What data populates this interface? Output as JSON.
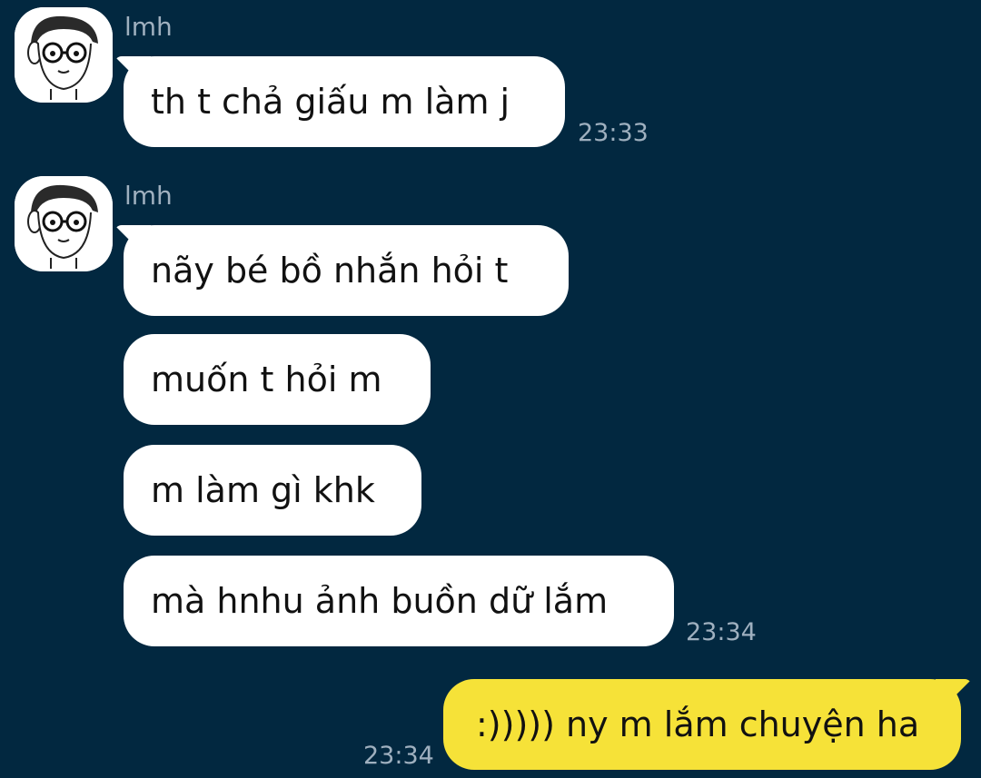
{
  "messages": [
    {
      "sender": "lmh",
      "text": "th t chả giấu m làm j",
      "time": "23:33"
    },
    {
      "sender": "lmh",
      "text": "nãy bé bồ nhắn hỏi t"
    },
    {
      "text": "muốn t hỏi m"
    },
    {
      "text": "m làm gì khk"
    },
    {
      "text": "mà hnhu ảnh buồn dữ lắm",
      "time": "23:34"
    },
    {
      "text": ":))))) ny m lắm chuyện ha",
      "time": "23:34",
      "from_me": true
    }
  ],
  "colors": {
    "background": "#022840",
    "incoming_bubble": "#ffffff",
    "outgoing_bubble": "#f6e238",
    "meta_text": "#9fb0bf"
  },
  "icons": {
    "avatar": "cartoon-boy-with-glasses-avatar"
  }
}
